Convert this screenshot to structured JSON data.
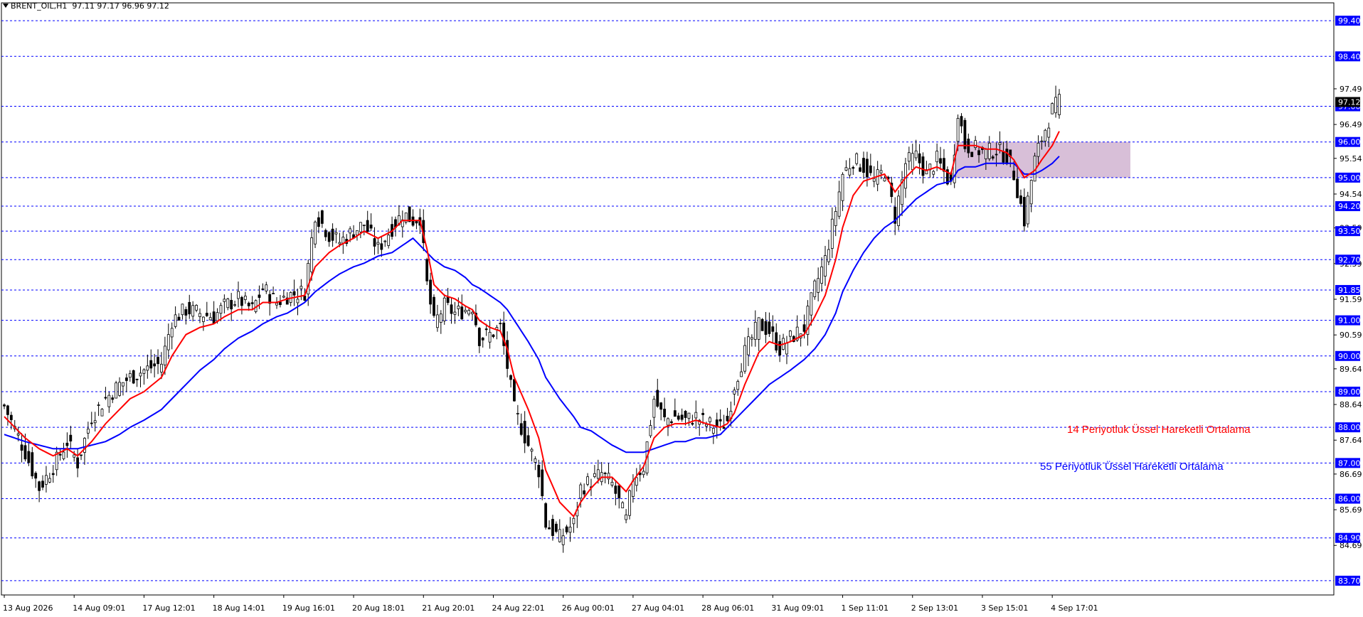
{
  "header": {
    "symbol": "BRENT_OIL,H1",
    "ohlc": "97.11 97.17 96.96 97.12"
  },
  "legend": {
    "ema14": "14 Periyotluk Üssel Hareketli Ortalama",
    "ema55": "55 Periyotluk Üssel Hareketli Ortalama"
  },
  "colors": {
    "ema14": "#ff0000",
    "ema55": "#0000ff",
    "candles": "#000000",
    "level_lines": "#0000ff",
    "zone": "#d8bfd8",
    "price_label_bg": "#0000ff"
  },
  "chart_data": {
    "type": "candlestick",
    "y_range": [
      83.3,
      99.9
    ],
    "price_axis_ticks": [
      "97.49",
      "96.49",
      "95.54",
      "94.54",
      "93.59",
      "92.59",
      "91.59",
      "90.59",
      "89.64",
      "88.64",
      "87.64",
      "86.69",
      "85.69",
      "84.69"
    ],
    "horizontal_levels": [
      "99.40",
      "98.40",
      "97.00",
      "96.00",
      "95.00",
      "94.20",
      "93.50",
      "92.70",
      "91.85",
      "91.00",
      "90.00",
      "89.00",
      "88.00",
      "87.00",
      "86.00",
      "84.90",
      "83.70"
    ],
    "current_price": "97.12",
    "x_labels": [
      "13 Aug 2026",
      "14 Aug 09:01",
      "17 Aug 12:01",
      "18 Aug 14:01",
      "19 Aug 16:01",
      "20 Aug 18:01",
      "21 Aug 20:01",
      "24 Aug 22:01",
      "26 Aug 00:01",
      "27 Aug 04:01",
      "28 Aug 06:01",
      "31 Aug 09:01",
      "1 Sep 11:01",
      "2 Sep 13:01",
      "3 Sep 15:01",
      "4 Sep 17:01"
    ],
    "zone": {
      "low": 95.0,
      "high": 96.0
    },
    "close_path": [
      [
        0,
        88.6
      ],
      [
        6,
        87.3
      ],
      [
        10,
        86.3
      ],
      [
        14,
        86.9
      ],
      [
        18,
        87.6
      ],
      [
        21,
        87.0
      ],
      [
        25,
        88.3
      ],
      [
        29,
        88.8
      ],
      [
        33,
        89.2
      ],
      [
        36,
        89.4
      ],
      [
        40,
        89.6
      ],
      [
        45,
        89.8
      ],
      [
        48,
        91.0
      ],
      [
        52,
        91.3
      ],
      [
        56,
        91.2
      ],
      [
        60,
        91.1
      ],
      [
        63,
        91.4
      ],
      [
        67,
        91.6
      ],
      [
        71,
        91.3
      ],
      [
        74,
        91.9
      ],
      [
        78,
        91.5
      ],
      [
        81,
        91.7
      ],
      [
        86,
        91.8
      ],
      [
        89,
        94.0
      ],
      [
        93,
        93.4
      ],
      [
        96,
        93.2
      ],
      [
        100,
        93.5
      ],
      [
        103,
        93.7
      ],
      [
        107,
        93.0
      ],
      [
        111,
        93.6
      ],
      [
        114,
        94.0
      ],
      [
        117,
        93.8
      ],
      [
        119,
        93.9
      ],
      [
        121,
        92.0
      ],
      [
        123,
        90.9
      ],
      [
        126,
        91.4
      ],
      [
        129,
        91.2
      ],
      [
        132,
        91.3
      ],
      [
        134,
        91.4
      ],
      [
        136,
        90.5
      ],
      [
        139,
        90.6
      ],
      [
        142,
        90.8
      ],
      [
        144,
        89.7
      ],
      [
        146,
        88.5
      ],
      [
        150,
        87.5
      ],
      [
        153,
        86.8
      ],
      [
        155,
        85.3
      ],
      [
        159,
        84.9
      ],
      [
        163,
        85.3
      ],
      [
        165,
        86.3
      ],
      [
        168,
        86.5
      ],
      [
        171,
        86.7
      ],
      [
        174,
        86.4
      ],
      [
        178,
        85.4
      ],
      [
        180,
        86.6
      ],
      [
        183,
        86.9
      ],
      [
        186,
        88.8
      ],
      [
        189,
        88.2
      ],
      [
        192,
        88.3
      ],
      [
        195,
        88.2
      ],
      [
        198,
        88.3
      ],
      [
        201,
        88.1
      ],
      [
        205,
        88.0
      ],
      [
        207,
        88.2
      ],
      [
        209,
        89.2
      ],
      [
        212,
        90.1
      ],
      [
        216,
        90.9
      ],
      [
        219,
        90.7
      ],
      [
        222,
        90.2
      ],
      [
        225,
        90.5
      ],
      [
        229,
        90.8
      ],
      [
        232,
        91.9
      ],
      [
        235,
        92.7
      ],
      [
        238,
        94.1
      ],
      [
        240,
        95.1
      ],
      [
        243,
        95.5
      ],
      [
        246,
        95.3
      ],
      [
        249,
        94.9
      ],
      [
        252,
        95.2
      ],
      [
        255,
        93.9
      ],
      [
        258,
        95.4
      ],
      [
        261,
        95.6
      ],
      [
        264,
        95.1
      ],
      [
        267,
        95.5
      ],
      [
        271,
        94.8
      ],
      [
        273,
        96.9
      ],
      [
        275,
        95.9
      ],
      [
        278,
        95.8
      ],
      [
        281,
        95.7
      ],
      [
        284,
        95.8
      ],
      [
        287,
        95.6
      ],
      [
        289,
        95.1
      ],
      [
        292,
        93.8
      ],
      [
        295,
        95.5
      ],
      [
        297,
        96.1
      ],
      [
        300,
        96.9
      ],
      [
        302,
        97.12
      ]
    ],
    "ema14_path": [
      [
        0,
        88.3
      ],
      [
        6,
        87.7
      ],
      [
        10,
        87.4
      ],
      [
        14,
        87.2
      ],
      [
        18,
        87.4
      ],
      [
        21,
        87.2
      ],
      [
        25,
        87.6
      ],
      [
        29,
        88.1
      ],
      [
        33,
        88.5
      ],
      [
        36,
        88.8
      ],
      [
        40,
        89.0
      ],
      [
        45,
        89.4
      ],
      [
        48,
        90.0
      ],
      [
        52,
        90.6
      ],
      [
        56,
        90.8
      ],
      [
        60,
        90.9
      ],
      [
        63,
        91.1
      ],
      [
        67,
        91.3
      ],
      [
        71,
        91.3
      ],
      [
        74,
        91.5
      ],
      [
        78,
        91.5
      ],
      [
        81,
        91.6
      ],
      [
        86,
        91.7
      ],
      [
        89,
        92.5
      ],
      [
        93,
        92.9
      ],
      [
        96,
        93.1
      ],
      [
        100,
        93.3
      ],
      [
        103,
        93.5
      ],
      [
        107,
        93.3
      ],
      [
        111,
        93.5
      ],
      [
        114,
        93.8
      ],
      [
        117,
        93.8
      ],
      [
        119,
        93.8
      ],
      [
        121,
        93.0
      ],
      [
        123,
        92.0
      ],
      [
        126,
        91.7
      ],
      [
        129,
        91.6
      ],
      [
        132,
        91.4
      ],
      [
        134,
        91.3
      ],
      [
        136,
        91.0
      ],
      [
        139,
        90.8
      ],
      [
        142,
        90.7
      ],
      [
        144,
        90.2
      ],
      [
        146,
        89.4
      ],
      [
        150,
        88.5
      ],
      [
        153,
        87.7
      ],
      [
        155,
        86.8
      ],
      [
        159,
        85.9
      ],
      [
        163,
        85.5
      ],
      [
        165,
        85.9
      ],
      [
        168,
        86.3
      ],
      [
        171,
        86.6
      ],
      [
        174,
        86.6
      ],
      [
        178,
        86.2
      ],
      [
        180,
        86.5
      ],
      [
        183,
        86.9
      ],
      [
        186,
        87.7
      ],
      [
        189,
        88.0
      ],
      [
        192,
        88.1
      ],
      [
        195,
        88.1
      ],
      [
        198,
        88.2
      ],
      [
        201,
        88.1
      ],
      [
        205,
        88.0
      ],
      [
        207,
        88.1
      ],
      [
        209,
        88.4
      ],
      [
        212,
        89.2
      ],
      [
        216,
        90.1
      ],
      [
        219,
        90.4
      ],
      [
        222,
        90.3
      ],
      [
        225,
        90.4
      ],
      [
        229,
        90.6
      ],
      [
        232,
        91.1
      ],
      [
        235,
        91.7
      ],
      [
        238,
        92.7
      ],
      [
        240,
        93.6
      ],
      [
        243,
        94.5
      ],
      [
        246,
        94.9
      ],
      [
        249,
        95.0
      ],
      [
        252,
        95.1
      ],
      [
        255,
        94.6
      ],
      [
        258,
        95.0
      ],
      [
        261,
        95.3
      ],
      [
        264,
        95.2
      ],
      [
        267,
        95.3
      ],
      [
        271,
        95.1
      ],
      [
        273,
        95.9
      ],
      [
        275,
        95.9
      ],
      [
        278,
        95.9
      ],
      [
        281,
        95.8
      ],
      [
        284,
        95.8
      ],
      [
        287,
        95.7
      ],
      [
        289,
        95.5
      ],
      [
        292,
        95.0
      ],
      [
        295,
        95.2
      ],
      [
        297,
        95.5
      ],
      [
        300,
        95.9
      ],
      [
        302,
        96.3
      ]
    ],
    "ema55_path": [
      [
        0,
        87.8
      ],
      [
        6,
        87.6
      ],
      [
        10,
        87.5
      ],
      [
        14,
        87.4
      ],
      [
        18,
        87.4
      ],
      [
        21,
        87.4
      ],
      [
        25,
        87.5
      ],
      [
        29,
        87.6
      ],
      [
        33,
        87.8
      ],
      [
        36,
        88.0
      ],
      [
        40,
        88.2
      ],
      [
        45,
        88.5
      ],
      [
        48,
        88.8
      ],
      [
        52,
        89.2
      ],
      [
        56,
        89.6
      ],
      [
        60,
        89.9
      ],
      [
        63,
        90.2
      ],
      [
        67,
        90.5
      ],
      [
        71,
        90.7
      ],
      [
        74,
        90.9
      ],
      [
        78,
        91.1
      ],
      [
        81,
        91.2
      ],
      [
        86,
        91.5
      ],
      [
        89,
        91.8
      ],
      [
        93,
        92.1
      ],
      [
        96,
        92.3
      ],
      [
        100,
        92.5
      ],
      [
        103,
        92.6
      ],
      [
        107,
        92.8
      ],
      [
        111,
        92.9
      ],
      [
        114,
        93.1
      ],
      [
        117,
        93.3
      ],
      [
        119,
        93.1
      ],
      [
        121,
        92.9
      ],
      [
        123,
        92.7
      ],
      [
        126,
        92.5
      ],
      [
        129,
        92.4
      ],
      [
        132,
        92.2
      ],
      [
        134,
        92.0
      ],
      [
        136,
        91.9
      ],
      [
        139,
        91.7
      ],
      [
        142,
        91.5
      ],
      [
        144,
        91.3
      ],
      [
        146,
        91.0
      ],
      [
        150,
        90.4
      ],
      [
        153,
        89.9
      ],
      [
        155,
        89.4
      ],
      [
        159,
        88.8
      ],
      [
        163,
        88.3
      ],
      [
        165,
        88.0
      ],
      [
        168,
        87.9
      ],
      [
        171,
        87.7
      ],
      [
        174,
        87.5
      ],
      [
        178,
        87.3
      ],
      [
        180,
        87.3
      ],
      [
        183,
        87.3
      ],
      [
        186,
        87.4
      ],
      [
        189,
        87.5
      ],
      [
        192,
        87.6
      ],
      [
        195,
        87.6
      ],
      [
        198,
        87.7
      ],
      [
        201,
        87.7
      ],
      [
        205,
        87.8
      ],
      [
        207,
        88.0
      ],
      [
        209,
        88.2
      ],
      [
        212,
        88.5
      ],
      [
        216,
        88.9
      ],
      [
        219,
        89.2
      ],
      [
        222,
        89.4
      ],
      [
        225,
        89.6
      ],
      [
        229,
        89.9
      ],
      [
        232,
        90.2
      ],
      [
        235,
        90.6
      ],
      [
        238,
        91.2
      ],
      [
        240,
        91.8
      ],
      [
        243,
        92.4
      ],
      [
        246,
        92.9
      ],
      [
        249,
        93.3
      ],
      [
        252,
        93.6
      ],
      [
        255,
        93.8
      ],
      [
        258,
        94.1
      ],
      [
        261,
        94.4
      ],
      [
        264,
        94.6
      ],
      [
        267,
        94.8
      ],
      [
        271,
        94.9
      ],
      [
        273,
        95.2
      ],
      [
        275,
        95.3
      ],
      [
        278,
        95.3
      ],
      [
        281,
        95.4
      ],
      [
        284,
        95.4
      ],
      [
        287,
        95.4
      ],
      [
        289,
        95.4
      ],
      [
        292,
        95.1
      ],
      [
        295,
        95.1
      ],
      [
        297,
        95.2
      ],
      [
        300,
        95.4
      ],
      [
        302,
        95.6
      ]
    ]
  }
}
